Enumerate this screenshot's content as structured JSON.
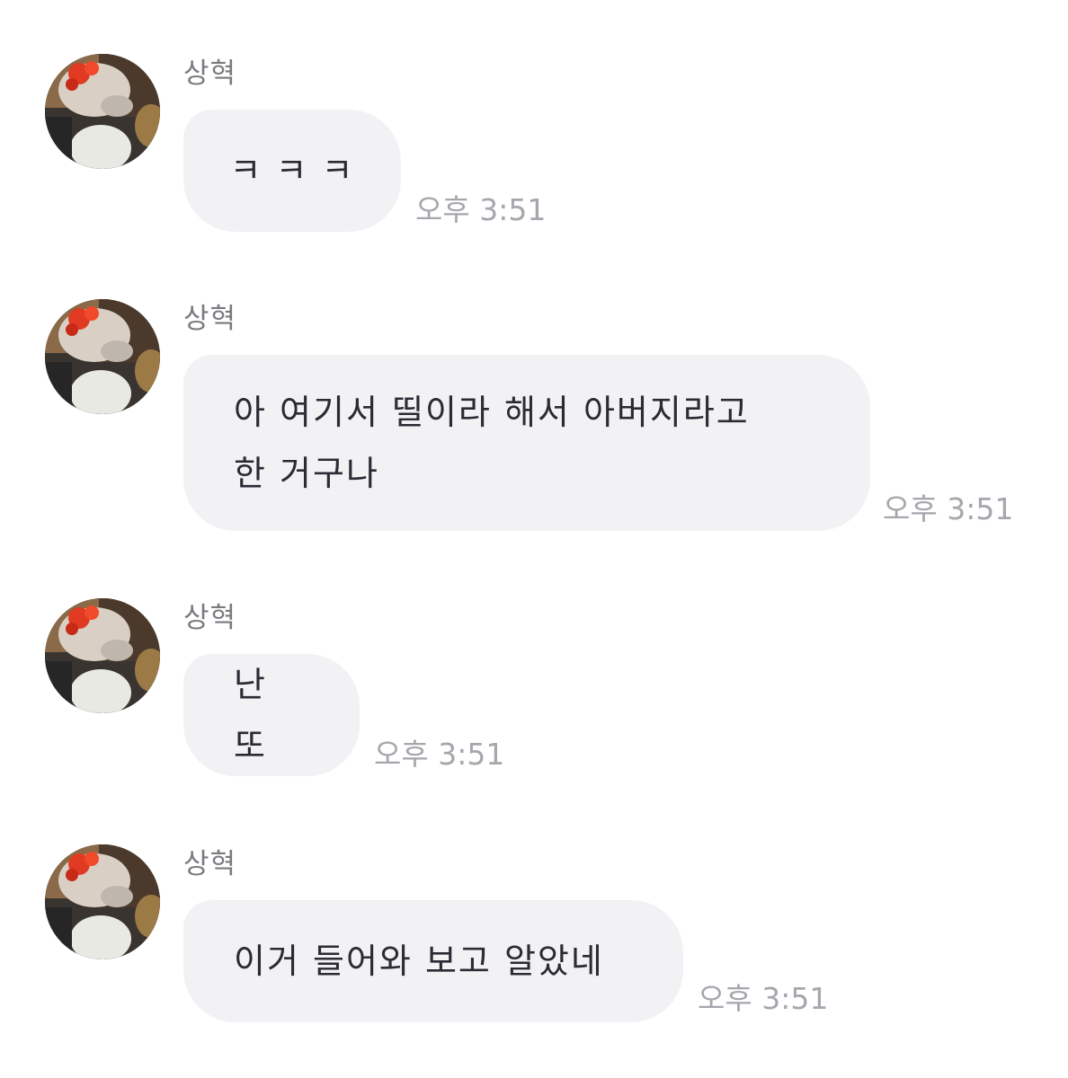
{
  "messages": [
    {
      "sender": "상혁",
      "text": "ㅋ ㅋ ㅋ",
      "time": "오후 3:51"
    },
    {
      "sender": "상혁",
      "text": "아 여기서 띨이라 해서 아버지라고\n한 거구나",
      "time": "오후 3:51"
    },
    {
      "sender": "상혁",
      "text": "난 또",
      "time": "오후 3:51"
    },
    {
      "sender": "상혁",
      "text": "이거 들어와 보고 알았네",
      "time": "오후 3:51"
    }
  ],
  "avatar_icon": "profile-photo-food-plate"
}
